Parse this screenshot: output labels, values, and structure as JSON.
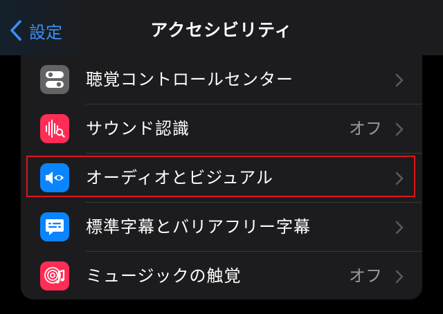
{
  "nav": {
    "back_label": "設定",
    "title": "アクセシビリティ"
  },
  "rows": [
    {
      "label": "聴覚コントロールセンター",
      "value": "",
      "icon": "toggles-icon",
      "icon_bg": "#636366"
    },
    {
      "label": "サウンド認識",
      "value": "オフ",
      "icon": "sound-recognition-icon",
      "icon_bg": "#ff2d55"
    },
    {
      "label": "オーディオとビジュアル",
      "value": "",
      "icon": "audio-visual-icon",
      "icon_bg": "#0a84ff"
    },
    {
      "label": "標準字幕とバリアフリー字幕",
      "value": "",
      "icon": "subtitles-icon",
      "icon_bg": "#0a84ff"
    },
    {
      "label": "ミュージックの触覚",
      "value": "オフ",
      "icon": "music-haptics-icon",
      "icon_bg": "#ff2d55"
    }
  ],
  "colors": {
    "accent": "#3b8ff6",
    "highlight_border": "#e0141b"
  }
}
